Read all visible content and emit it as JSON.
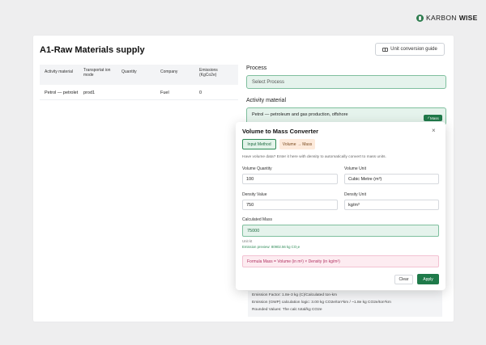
{
  "brand": {
    "prefix": "KARBON",
    "suffix": "WISE"
  },
  "page": {
    "title": "A1-Raw Materials supply",
    "unit_guide_label": "Unit conversion guide"
  },
  "table": {
    "headers": [
      "Activity material",
      "Transportat ion mode",
      "Quantity",
      "Company",
      "Emissions (KgCo2e)"
    ],
    "rows": [
      {
        "activity": "Petrol — petrolet",
        "transport": "prod1",
        "quantity": "",
        "company": "Fuel",
        "emissions": "0"
      }
    ]
  },
  "form": {
    "process_label": "Process",
    "process_placeholder": "Select Process",
    "activity_label": "Activity material",
    "activity_value": "Petrol — petroleum and gas production, offshore",
    "mass_badge": "Mass"
  },
  "info_lines": [
    "Emission Factor: 1.8e-3 kg (C)/Calculated ton-km",
    "Emission (GWP) calculation logic: 3.00 kg CO2e/ton*km / ~1.8e kg CO2e/ton*km",
    "Rounded Values: The calc total/kg CO2e"
  ],
  "modal": {
    "title": "Volume to Mass Converter",
    "close_symbol": "×",
    "tab_input": "Input Method",
    "tab_volume": "Volume → Mass",
    "hint": "Have volume data? Enter it here with density to automatically convert to mass units.",
    "volume_qty_label": "Volume Quantity",
    "volume_qty_value": "100",
    "volume_unit_label": "Volume Unit",
    "volume_unit_value": "Cubic Metre (m³)",
    "density_value_label": "Density Value",
    "density_value": "750",
    "density_unit_label": "Density Unit",
    "density_unit_value": "kg/m³",
    "calc_label": "Calculated Mass",
    "calc_value": "75000",
    "unit_note": "Unit kt",
    "preview": "Emission preview: 80902.56 kg CO₂e",
    "formula": "Formula Mass = Volume (in m³) × Density (in kg/m³)",
    "clear_label": "Clear",
    "apply_label": "Apply"
  }
}
